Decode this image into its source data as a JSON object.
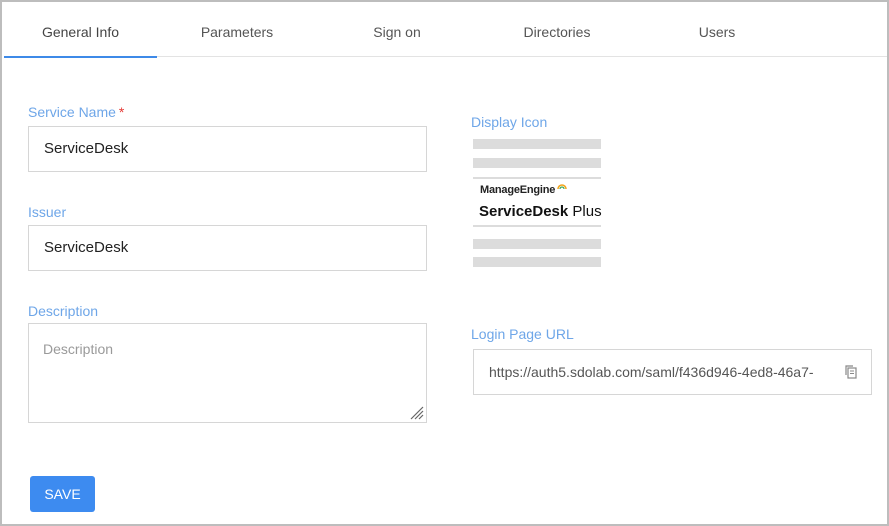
{
  "tabs": [
    {
      "label": "General Info",
      "active": true
    },
    {
      "label": "Parameters",
      "active": false
    },
    {
      "label": "Sign on",
      "active": false
    },
    {
      "label": "Directories",
      "active": false
    },
    {
      "label": "Users",
      "active": false
    }
  ],
  "form": {
    "service_name_label": "Service Name",
    "required_marker": "*",
    "service_name_value": "ServiceDesk",
    "issuer_label": "Issuer",
    "issuer_value": "ServiceDesk",
    "description_label": "Description",
    "description_placeholder": "Description",
    "display_icon_label": "Display Icon",
    "login_url_label": "Login Page URL",
    "login_url_value": "https://auth5.sdolab.com/saml/f436d946-4ed8-46a7-",
    "save_label": "SAVE"
  },
  "display_icon": {
    "brand_name": "ManageEngine",
    "product_name_bold": "ServiceDesk",
    "product_name_suffix": " Plus"
  },
  "colors": {
    "accent": "#3e8ae8",
    "label": "#6ea6e8",
    "required": "#e53935",
    "save_button": "#3d8bf0"
  }
}
